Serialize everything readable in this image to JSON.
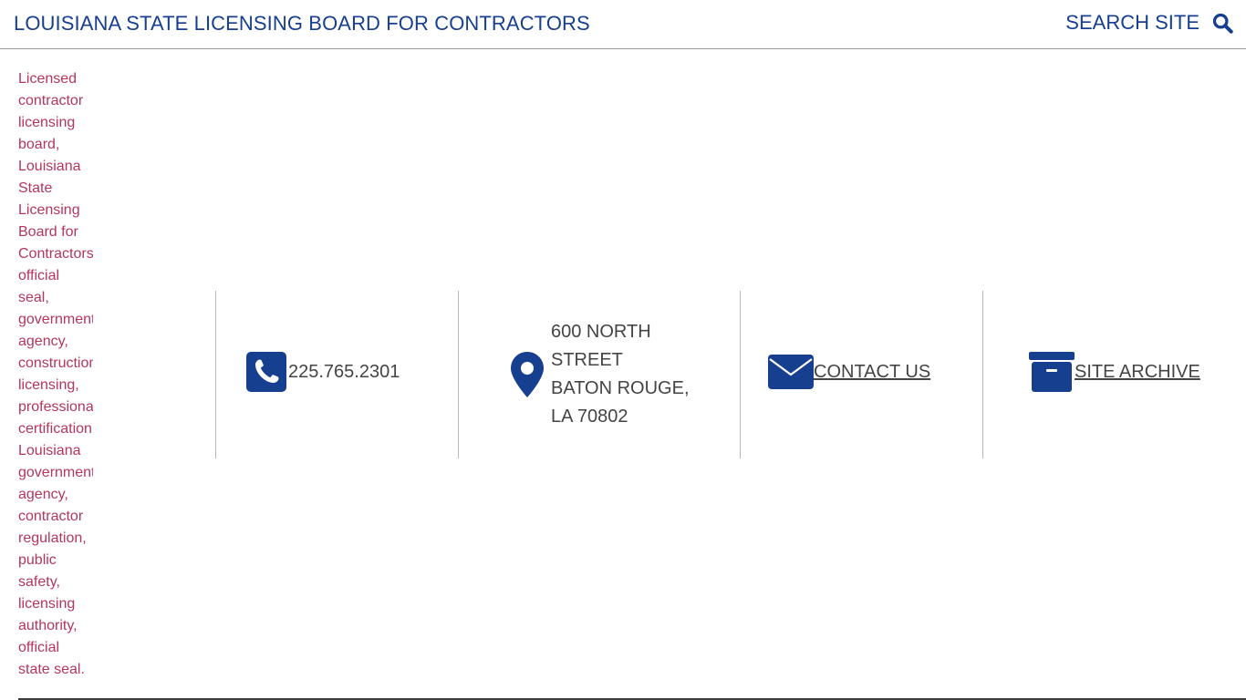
{
  "header": {
    "title": "LOUISIANA STATE LICENSING BOARD FOR CONTRACTORS",
    "search_label": "SEARCH SITE",
    "search_icon": "search-icon",
    "brand_color": "#173f8f"
  },
  "seal_image": {
    "alt_lines": [
      "Licensed",
      "contractor",
      "licensing",
      "board,",
      "Louisiana",
      "State",
      "Licensing",
      "Board for",
      "Contractors",
      "official",
      "seal,",
      "government",
      "agency,",
      "construction",
      "licensing,",
      "professional",
      "certification",
      "Louisiana",
      "government",
      "agency,",
      "contractor",
      "regulation,",
      "public",
      "safety,",
      "licensing",
      "authority,",
      "official",
      "state seal."
    ],
    "alt_color": "#b4365c"
  },
  "contact_bar": {
    "phone": {
      "icon": "phone-icon",
      "number": "225.765.2301"
    },
    "address": {
      "icon": "map-marker-icon",
      "line1": "600 NORTH",
      "line2": "STREET",
      "line3": "BATON ROUGE,",
      "line4": "LA 70802"
    },
    "contact": {
      "icon": "envelope-icon",
      "label": "CONTACT US"
    },
    "archive": {
      "icon": "archive-box-icon",
      "label": "SITE ARCHIVE"
    }
  }
}
